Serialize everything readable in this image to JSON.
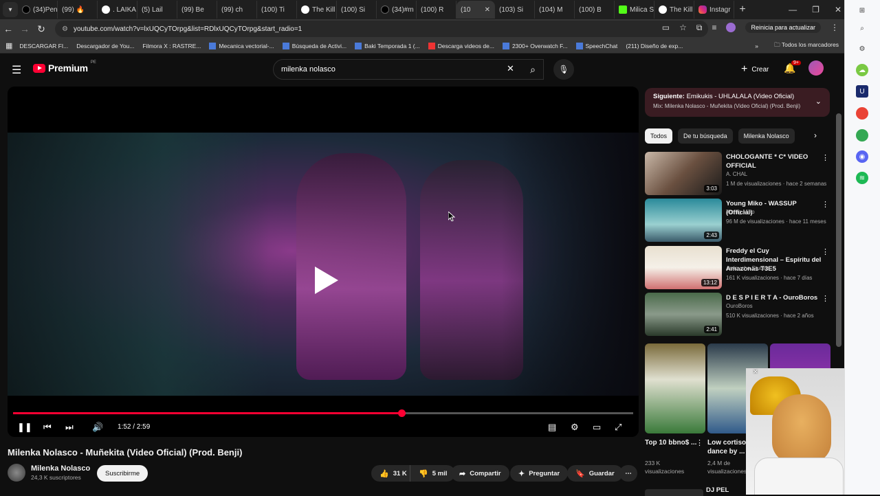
{
  "browser": {
    "tabs": [
      {
        "label": "(34)Pen",
        "icon": "tiktok"
      },
      {
        "label": "(99) 🔥",
        "icon": "youtube"
      },
      {
        "label": ". LAIKA",
        "icon": "threads"
      },
      {
        "label": "(5) Lail",
        "icon": "youtube"
      },
      {
        "label": "(99) Be",
        "icon": "youtube"
      },
      {
        "label": "(99) ch",
        "icon": "youtube"
      },
      {
        "label": "(100) Ti",
        "icon": "youtube"
      },
      {
        "label": "The Kill",
        "icon": "threads"
      },
      {
        "label": "(100) Si",
        "icon": "youtube"
      },
      {
        "label": "(34)#m",
        "icon": "tiktok"
      },
      {
        "label": "(100) R",
        "icon": "youtube"
      },
      {
        "label": "(10",
        "icon": "youtube"
      },
      {
        "label": "(103) Si",
        "icon": "youtube"
      },
      {
        "label": "(104) M",
        "icon": "youtube"
      },
      {
        "label": "(100) B",
        "icon": "youtube"
      },
      {
        "label": "Milica S",
        "icon": "kick"
      },
      {
        "label": "The Kill",
        "icon": "threads"
      },
      {
        "label": "Instagr",
        "icon": "instagram"
      }
    ],
    "url": "youtube.com/watch?v=lxUQCyTOrpg&list=RDlxUQCyTOrpg&start_radio=1",
    "update_label": "Reinicia para actualizar",
    "bookmarks": [
      {
        "label": "DESCARGAR FI...",
        "icon": "youtube"
      },
      {
        "label": "Descargador de You...",
        "icon": "youtube"
      },
      {
        "label": "Filmora X : RASTRE...",
        "icon": "youtube"
      },
      {
        "label": "Mecanica vectorial-...",
        "icon": "link"
      },
      {
        "label": "Búsqueda de Activi...",
        "icon": "link"
      },
      {
        "label": "Baki Temporada 1 (...",
        "icon": "link"
      },
      {
        "label": "Descarga videos de...",
        "icon": "download"
      },
      {
        "label": "2300+ Overwatch F...",
        "icon": "link"
      },
      {
        "label": "SpeechChat",
        "icon": "link"
      },
      {
        "label": "(211) Diseño de exp...",
        "icon": "youtube"
      }
    ],
    "all_bookmarks": "Todos los marcadores"
  },
  "masthead": {
    "logo_text": "Premium",
    "country": "PE",
    "search_value": "milenka nolasco",
    "create_label": "Crear",
    "notif_count": "9+"
  },
  "player": {
    "time": "1:52 / 2:59",
    "progress": 0.626
  },
  "video": {
    "title": "Milenka Nolasco - Muñekita (Video Oficial) (Prod. Benji)",
    "channel": "Milenka Nolasco",
    "subscribers": "24,3 K suscriptores",
    "subscribe_label": "Suscribirme",
    "likes": "31 K",
    "dislikes": "5 mil",
    "share_label": "Compartir",
    "ask_label": "Preguntar",
    "save_label": "Guardar"
  },
  "up_next": {
    "prefix": "Siguiente:",
    "title": "Emikukis - UHLALALA (Video Oficial)",
    "mix": "Mix: Milenka Nolasco - Muñekita (Video Oficial) (Prod. Benji)"
  },
  "chips": [
    "Todos",
    "De tu búsqueda",
    "Milenka Nolasco"
  ],
  "recommendations": [
    {
      "title": "CHOLOGANTE * C* VIDEO OFFICIAL",
      "channel": "A. CHAL",
      "meta": "1 M de visualizaciones · hace 2 semanas",
      "duration": "3:03"
    },
    {
      "title": "Young Miko - WASSUP (Official)",
      "channel": "Young Miko",
      "meta": "96 M de visualizaciones · hace 11 meses",
      "duration": "2:43"
    },
    {
      "title": "Freddy el Cuy Interdimensional – Espíritu del Amazonas T3E5",
      "channel": "Anticucho Studios",
      "meta": "161 K visualizaciones · hace 7 días",
      "duration": "13:12"
    },
    {
      "title": "D E S P I E R T A - OuroBoros",
      "channel": "OuroBoros",
      "meta": "510 K visualizaciones · hace 2 años",
      "duration": "2:41"
    }
  ],
  "shorts": [
    {
      "title": "Top 10 bbno$ ...",
      "meta": "233 K visualizaciones"
    },
    {
      "title": "Low cortiso dance by ...",
      "meta": "2,4 M de visualizaciones"
    }
  ],
  "next_partial": "DJ PEL"
}
